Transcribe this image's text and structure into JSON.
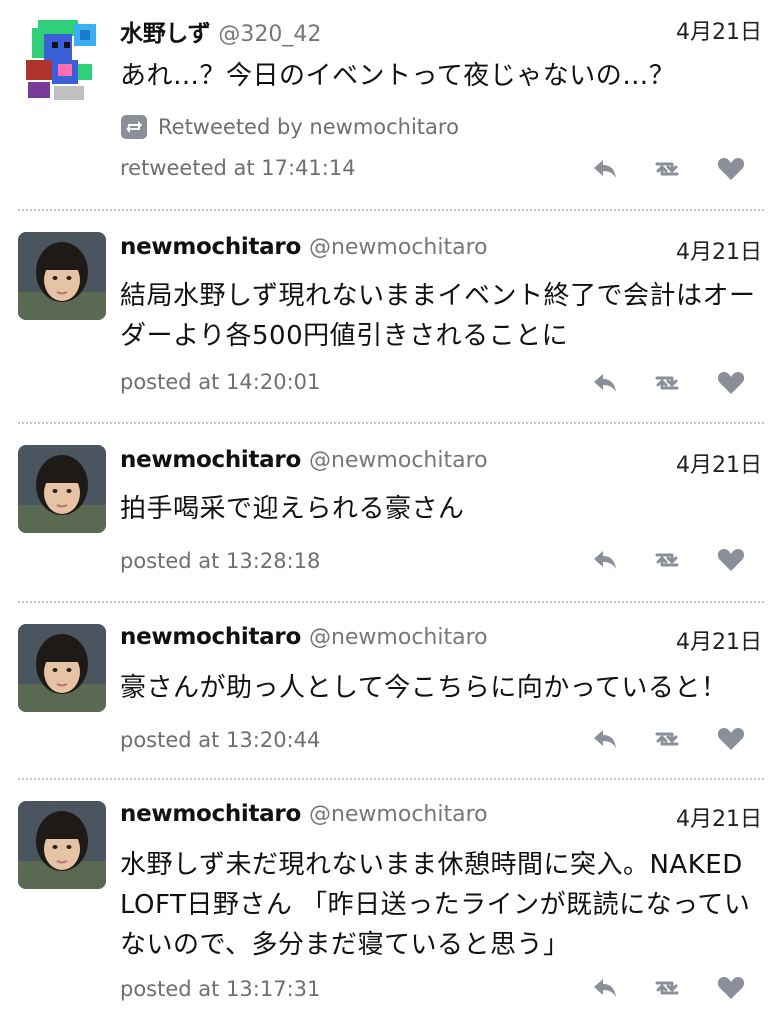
{
  "tweets": [
    {
      "name": "水野しず",
      "handle": "@320_42",
      "date": "4月21日",
      "text": "あれ…？今日のイベントって夜じゃないの…？",
      "retweet_label": "Retweeted by newmochitaro",
      "meta": "retweeted at 17:41:14",
      "avatar": "pixel-art-avatar"
    },
    {
      "name": "newmochitaro",
      "handle": "@newmochitaro",
      "date": "4月21日",
      "text": "結局水野しず現れないままイベント終了で会計はオーダーより各500円値引きされることに",
      "meta": "posted at 14:20:01",
      "avatar": "photo-avatar"
    },
    {
      "name": "newmochitaro",
      "handle": "@newmochitaro",
      "date": "4月21日",
      "text": "拍手喝采で迎えられる豪さん",
      "meta": "posted at 13:28:18",
      "avatar": "photo-avatar"
    },
    {
      "name": "newmochitaro",
      "handle": "@newmochitaro",
      "date": "4月21日",
      "text": "豪さんが助っ人として今こちらに向かっていると！",
      "meta": "posted at 13:20:44",
      "avatar": "photo-avatar"
    },
    {
      "name": "newmochitaro",
      "handle": "@newmochitaro",
      "date": "4月21日",
      "text": "水野しず未だ現れないまま休憩時間に突入。NAKED LOFT日野さん 「昨日送ったラインが既読になっていないので、多分まだ寝ていると思う」",
      "meta": "posted at 13:17:31",
      "avatar": "photo-avatar"
    }
  ],
  "icons": {
    "reply": "reply-icon",
    "retweet": "retweet-icon",
    "like": "heart-icon",
    "retweeted_by": "retweeted-by-icon"
  },
  "colors": {
    "icon_gray": "#8a8f99",
    "meta_gray": "#6f6f6f",
    "divider": "#c4c4c4"
  }
}
